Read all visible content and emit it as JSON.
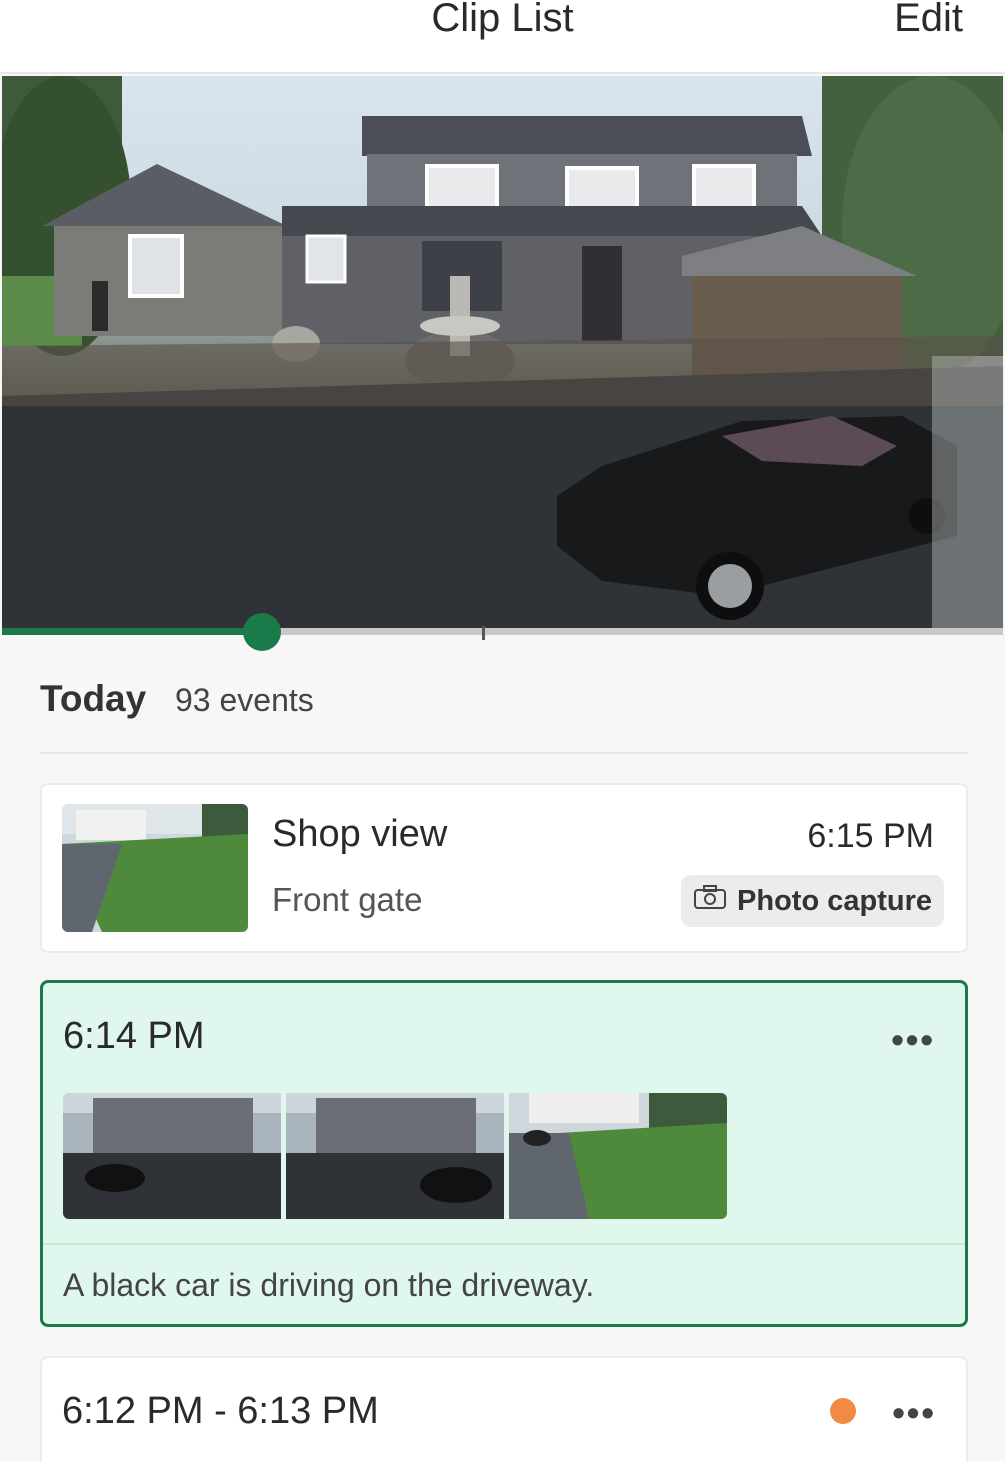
{
  "nav": {
    "title": "Clip List",
    "edit_label": "Edit"
  },
  "player": {
    "progress": 0.26
  },
  "day": {
    "label": "Today",
    "count": "93 events"
  },
  "events": [
    {
      "title": "Shop view",
      "subtitle": "Front gate",
      "time": "6:15 PM",
      "badge": {
        "icon": "camera-icon",
        "label": "Photo capture"
      }
    },
    {
      "time": "6:14 PM",
      "more": "•••",
      "description": "A black car is driving on the driveway.",
      "thumbnails": [
        "house-car-left",
        "house-car-right",
        "lawn-gate"
      ]
    },
    {
      "time": "6:12 PM - 6:13 PM",
      "more": "•••",
      "status_color": "#f08a45"
    }
  ],
  "colors": {
    "accent": "#1b7a4a",
    "selected_bg": "#dff7ec",
    "status_orange": "#f08a45"
  }
}
